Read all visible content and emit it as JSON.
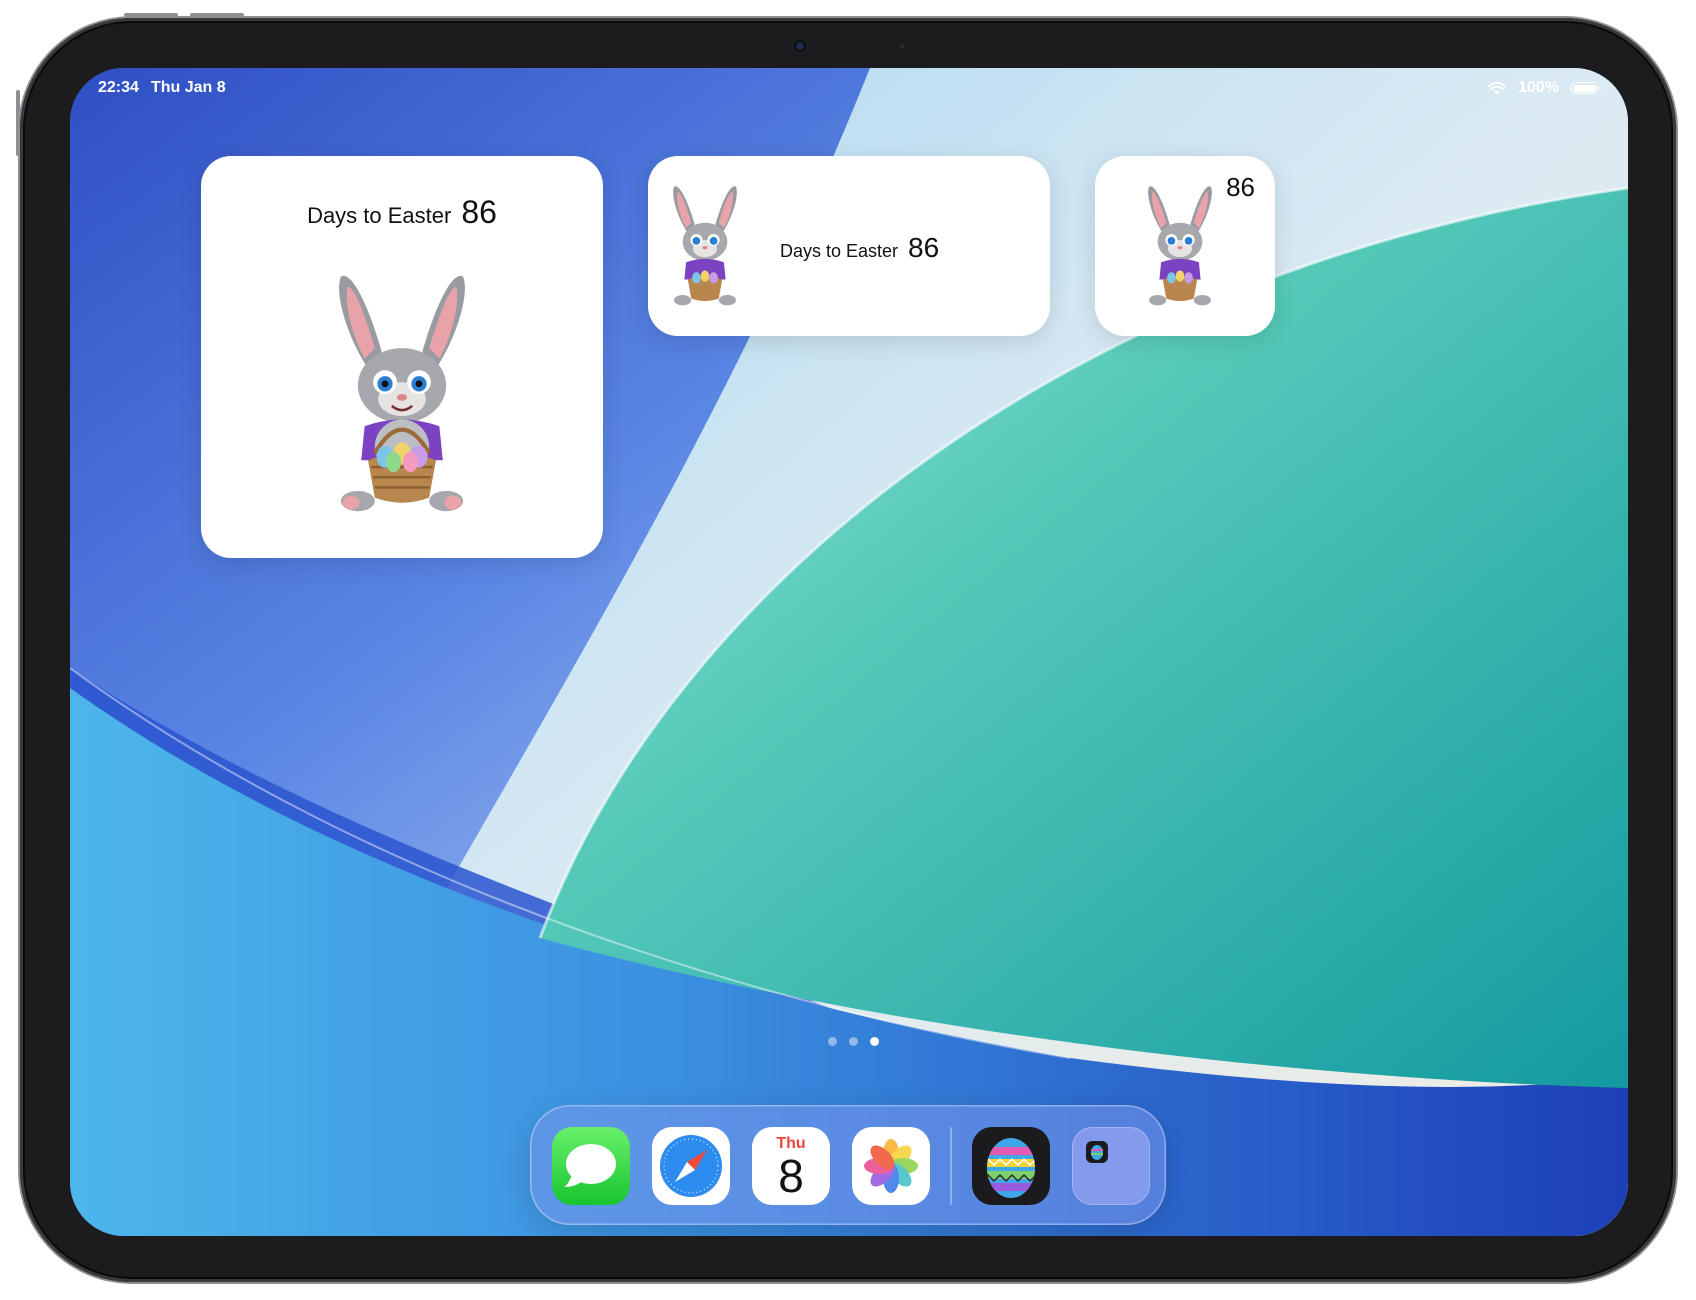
{
  "status_bar": {
    "time": "22:34",
    "date": "Thu Jan 8",
    "battery": "100%",
    "battery_level": 1.0
  },
  "widgets": {
    "large": {
      "label": "Days to Easter",
      "count": "86"
    },
    "medium": {
      "label": "Days to Easter",
      "count": "86"
    },
    "small": {
      "count": "86"
    }
  },
  "page_indicator": {
    "pages": 3,
    "current": 3
  },
  "dock": {
    "apps": [
      {
        "name": "Messages",
        "icon": "speech-bubble-icon"
      },
      {
        "name": "Safari",
        "icon": "compass-icon"
      },
      {
        "name": "Calendar",
        "icon": "calendar-icon"
      },
      {
        "name": "Photos",
        "icon": "flower-icon"
      },
      {
        "name": "Easter Egg",
        "icon": "easter-egg-icon"
      },
      {
        "name": "Folder",
        "icon": "folder-icon"
      }
    ],
    "calendar_day": "Thu",
    "calendar_date": "8"
  },
  "colors": {
    "wallpaper_blue": "#3d63d4",
    "wallpaper_teal": "#2fb9a6",
    "dock_tint": "#7896eb"
  }
}
